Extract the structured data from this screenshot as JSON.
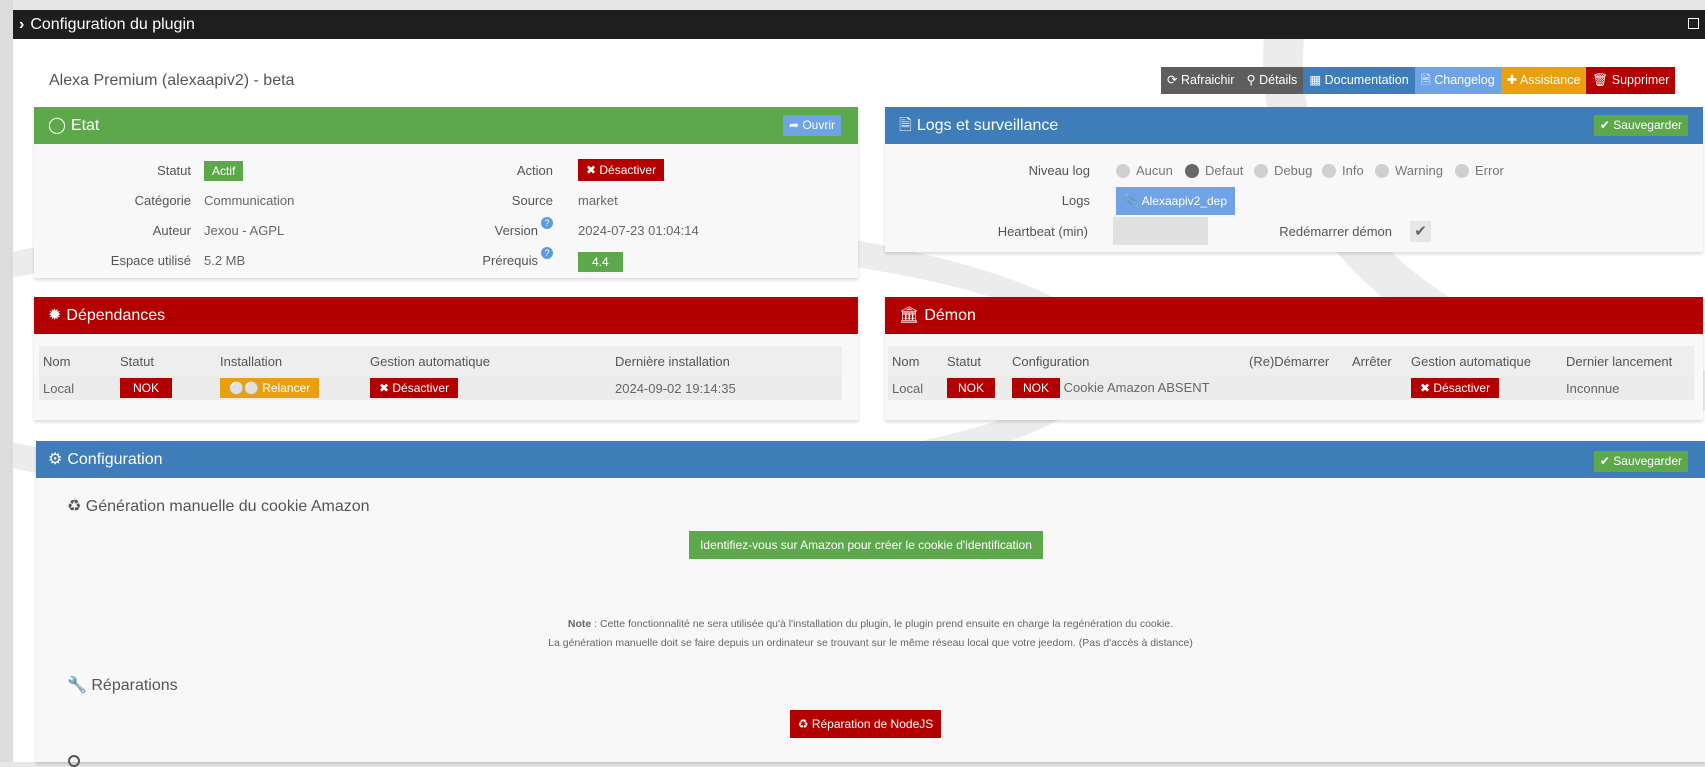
{
  "window": {
    "title": "Configuration du plugin"
  },
  "plugin_title": "Alexa Premium (alexaapiv2) - beta",
  "toolbar": [
    {
      "label": "Rafraichir",
      "icon": "refresh-icon",
      "color": "#5e5e5e"
    },
    {
      "label": "Détails",
      "icon": "search-icon",
      "color": "#5e5e5e"
    },
    {
      "label": "Documentation",
      "icon": "book-icon",
      "color": "#3e7cba"
    },
    {
      "label": "Changelog",
      "icon": "file-code-icon",
      "color": "#70a3e6"
    },
    {
      "label": "Assistance",
      "icon": "ambulance-icon",
      "color": "#e8a010"
    },
    {
      "label": "Supprimer",
      "icon": "trash-icon",
      "color": "#b30000"
    }
  ],
  "etat": {
    "title": "Etat",
    "open_label": "Ouvrir",
    "statut_label": "Statut",
    "statut": "Actif",
    "categorie_label": "Catégorie",
    "categorie": "Communication",
    "auteur_label": "Auteur",
    "auteur": "Jexou - AGPL",
    "espace_label": "Espace utilisé",
    "espace": "5.2 MB",
    "action_label": "Action",
    "action": "Désactiver",
    "source_label": "Source",
    "source": "market",
    "version_label": "Version",
    "version": "2024-07-23 01:04:14",
    "prerequis_label": "Prérequis",
    "prerequis": "4.4"
  },
  "logs": {
    "title": "Logs et surveillance",
    "save_label": "Sauvegarder",
    "niveau_label": "Niveau log",
    "levels": [
      "Aucun",
      "Defaut",
      "Debug",
      "Info",
      "Warning",
      "Error"
    ],
    "selected_level": "Defaut",
    "logs_label": "Logs",
    "log_file": "Alexaapiv2_dep",
    "heartbeat_label": "Heartbeat (min)",
    "heartbeat_value": "",
    "restart_label": "Redémarrer démon",
    "restart_checked": true
  },
  "dependances": {
    "title": "Dépendances",
    "headers": [
      "Nom",
      "Statut",
      "Installation",
      "Gestion automatique",
      "Dernière installation"
    ],
    "row": {
      "nom": "Local",
      "statut": "NOK",
      "installation": "Relancer",
      "gestion": "Désactiver",
      "derniere": "2024-09-02 19:14:35"
    }
  },
  "demon": {
    "title": "Démon",
    "headers": [
      "Nom",
      "Statut",
      "Configuration",
      "(Re)Démarrer",
      "Arrêter",
      "Gestion automatique",
      "Dernier lancement"
    ],
    "row": {
      "nom": "Local",
      "statut": "NOK",
      "config_status": "NOK",
      "config_text": "Cookie Amazon ABSENT",
      "gestion": "Désactiver",
      "dernier": "Inconnue"
    }
  },
  "configuration": {
    "title": "Configuration",
    "save_label": "Sauvegarder",
    "cookie_section": "Génération manuelle du cookie Amazon",
    "cookie_button": "Identifiez-vous sur Amazon pour créer le cookie d'identification",
    "note_bold": "Note",
    "note_line1": " : Cette fonctionnalité ne sera utilisée qu'à l'installation du plugin, le plugin prend ensuite en charge la regénération du cookie.",
    "note_line2": "La génération manuelle doit se faire depuis un ordinateur se trouvant sur le même réseau local que votre jeedom. (Pas d'accès à distance)",
    "repair_section": "Réparations",
    "repair_button": "Réparation de NodeJS"
  }
}
